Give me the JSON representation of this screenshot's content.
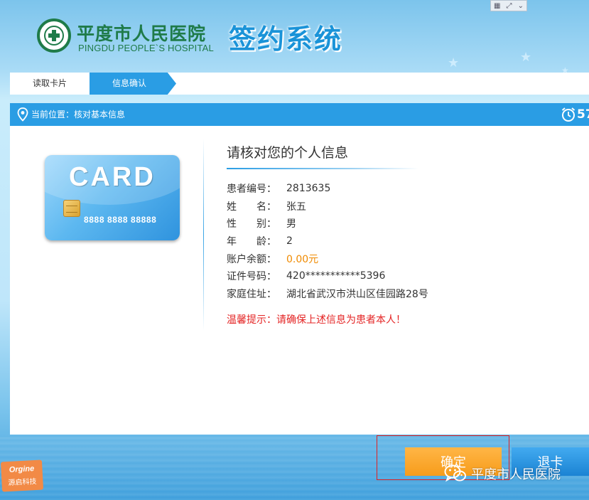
{
  "header": {
    "hospital_name_cn": "平度市人民医院",
    "hospital_name_en": "PINGDU PEOPLE`S HOSPITAL",
    "system_title": "签约系统"
  },
  "steps": [
    {
      "label": "读取卡片",
      "active": false
    },
    {
      "label": "信息确认",
      "active": true
    }
  ],
  "location": {
    "text": "当前位置：核对基本信息"
  },
  "countdown": "57",
  "card": {
    "label": "CARD",
    "number": "8888 8888 88888"
  },
  "info": {
    "title": "请核对您的个人信息",
    "rows": [
      {
        "label": "患者编号：",
        "value": "2813635"
      },
      {
        "label": "姓　　名：",
        "value": "张五"
      },
      {
        "label": "性　　别：",
        "value": "男"
      },
      {
        "label": "年　　龄：",
        "value": "2"
      },
      {
        "label": "账户余额：",
        "value": "0.00元"
      },
      {
        "label": "证件号码：",
        "value": "420***********5396"
      },
      {
        "label": "家庭住址：",
        "value": "湖北省武汉市洪山区佳园路28号"
      }
    ],
    "warning": "温馨提示：请确保上述信息为患者本人！"
  },
  "buttons": {
    "confirm": "确定",
    "return_card": "退卡"
  },
  "watermark": {
    "text": "平度市人民医院"
  },
  "vendor": {
    "name_en": "Orgine",
    "name_cn": "源启科技"
  },
  "colors": {
    "primary_blue": "#2a9de4",
    "hospital_green": "#1f7b49",
    "confirm_orange": "#f79c1b",
    "money_orange": "#f08a00",
    "warning_red": "#e42424"
  }
}
